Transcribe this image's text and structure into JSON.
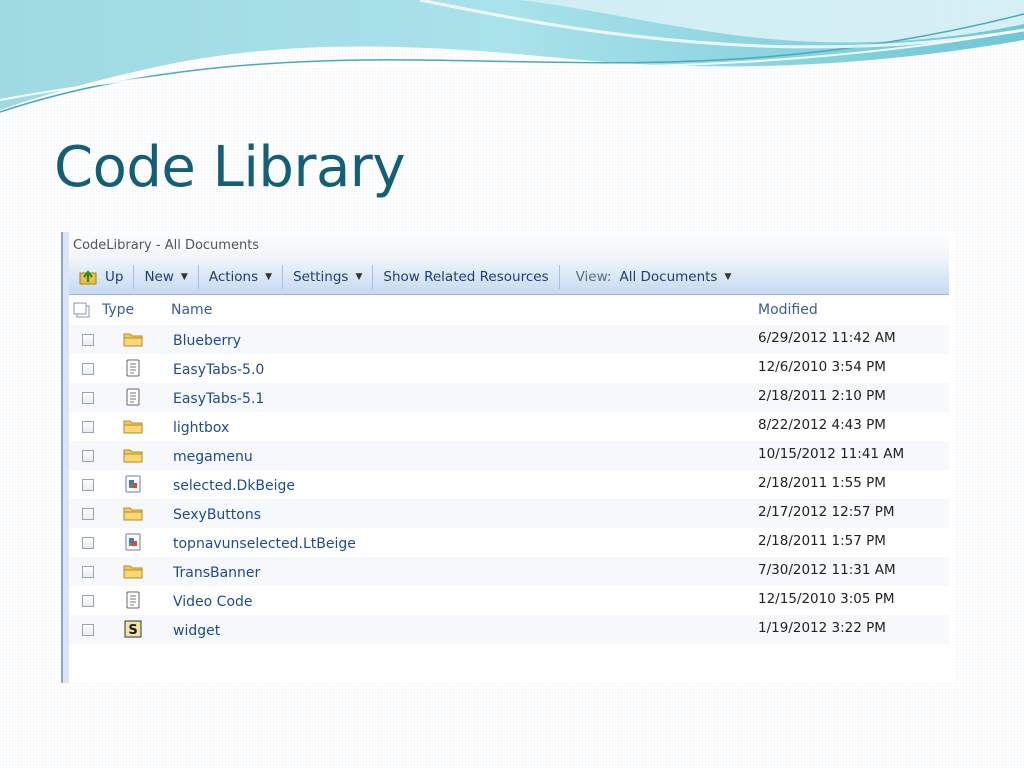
{
  "slide": {
    "title": "Code Library"
  },
  "window": {
    "title": "CodeLibrary - All Documents"
  },
  "toolbar": {
    "up": "Up",
    "new": "New",
    "actions": "Actions",
    "settings": "Settings",
    "show_related": "Show Related Resources",
    "view_label": "View:",
    "view_value": "All Documents"
  },
  "columns": {
    "type": "Type",
    "name": "Name",
    "modified": "Modified"
  },
  "items": [
    {
      "icon": "folder-icon",
      "name": "Blueberry",
      "modified": "6/29/2012 11:42 AM"
    },
    {
      "icon": "document-icon",
      "name": "EasyTabs-5.0",
      "modified": "12/6/2010 3:54 PM"
    },
    {
      "icon": "document-icon",
      "name": "EasyTabs-5.1",
      "modified": "2/18/2011 2:10 PM"
    },
    {
      "icon": "folder-icon",
      "name": "lightbox",
      "modified": "8/22/2012 4:43 PM"
    },
    {
      "icon": "folder-icon",
      "name": "megamenu",
      "modified": "10/15/2012 11:41 AM"
    },
    {
      "icon": "image-icon",
      "name": "selected.DkBeige",
      "modified": "2/18/2011 1:55 PM"
    },
    {
      "icon": "folder-icon",
      "name": "SexyButtons",
      "modified": "2/17/2012 12:57 PM"
    },
    {
      "icon": "image-icon",
      "name": "topnavunselected.LtBeige",
      "modified": "2/18/2011 1:57 PM"
    },
    {
      "icon": "folder-icon",
      "name": "TransBanner",
      "modified": "7/30/2012 11:31 AM"
    },
    {
      "icon": "document-icon",
      "name": "Video Code",
      "modified": "12/15/2010 3:05 PM"
    },
    {
      "icon": "script-icon",
      "name": "widget",
      "modified": "1/19/2012 3:22 PM"
    }
  ]
}
